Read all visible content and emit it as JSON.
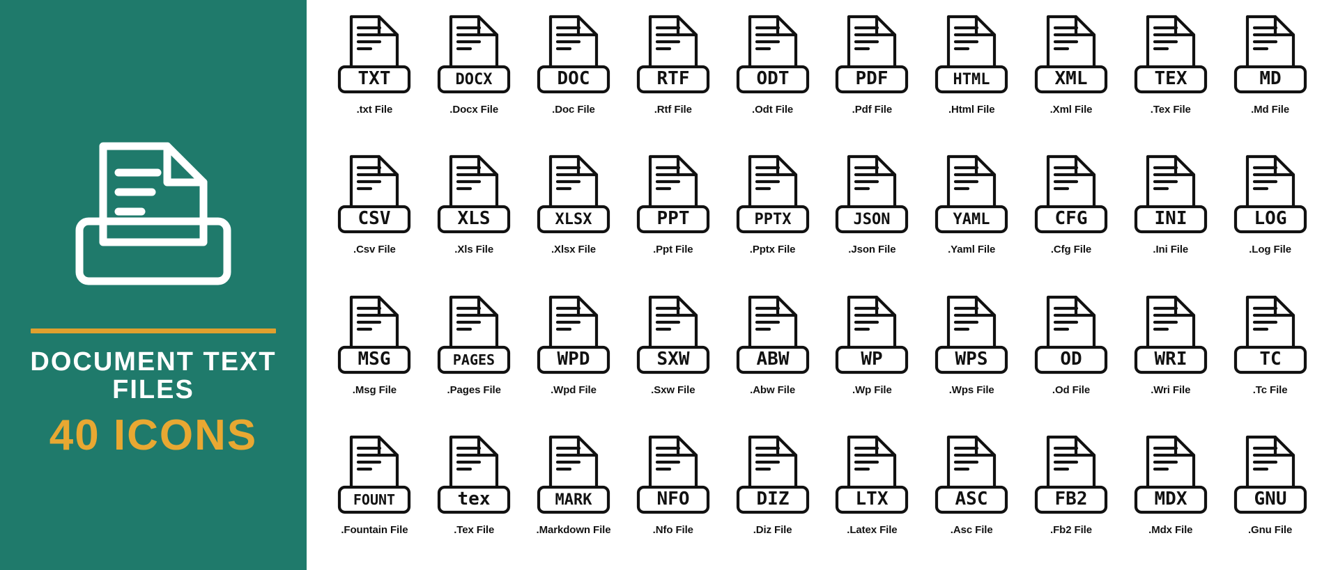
{
  "cover": {
    "logo_icon": "document-text-file-icon",
    "title": "DOCUMENT TEXT FILES",
    "count": "40 ICONS",
    "accent_color": "#e0a02e",
    "background_color": "#1f7a6b",
    "title_color": "#ffffff"
  },
  "grid": {
    "columns": 10,
    "rows": 4,
    "stroke_color": "#111111",
    "icons": [
      {
        "badge": "TXT",
        "caption": ".txt File",
        "icon": "txt-file-icon",
        "lines": 4
      },
      {
        "badge": "DOCX",
        "caption": ".Docx File",
        "icon": "docx-file-icon",
        "lines": 4
      },
      {
        "badge": "DOC",
        "caption": ".Doc File",
        "icon": "doc-file-icon",
        "lines": 4
      },
      {
        "badge": "RTF",
        "caption": ".Rtf File",
        "icon": "rtf-file-icon",
        "lines": 4
      },
      {
        "badge": "ODT",
        "caption": ".Odt File",
        "icon": "odt-file-icon",
        "lines": 4
      },
      {
        "badge": "PDF",
        "caption": ".Pdf File",
        "icon": "pdf-file-icon",
        "lines": 4
      },
      {
        "badge": "HTML",
        "caption": ".Html File",
        "icon": "html-file-icon",
        "lines": 4
      },
      {
        "badge": "XML",
        "caption": ".Xml File",
        "icon": "xml-file-icon",
        "lines": 4
      },
      {
        "badge": "TEX",
        "caption": ".Tex File",
        "icon": "tex-file-icon",
        "lines": 4
      },
      {
        "badge": "MD",
        "caption": ".Md File",
        "icon": "md-file-icon",
        "lines": 4
      },
      {
        "badge": "CSV",
        "caption": ".Csv File",
        "icon": "csv-file-icon",
        "lines": 4
      },
      {
        "badge": "XLS",
        "caption": ".Xls File",
        "icon": "xls-file-icon",
        "lines": 4
      },
      {
        "badge": "XLSX",
        "caption": ".Xlsx File",
        "icon": "xlsx-file-icon",
        "lines": 4
      },
      {
        "badge": "PPT",
        "caption": ".Ppt File",
        "icon": "ppt-file-icon",
        "lines": 4
      },
      {
        "badge": "PPTX",
        "caption": ".Pptx File",
        "icon": "pptx-file-icon",
        "lines": 4
      },
      {
        "badge": "JSON",
        "caption": ".Json File",
        "icon": "json-file-icon",
        "lines": 4
      },
      {
        "badge": "YAML",
        "caption": ".Yaml File",
        "icon": "yaml-file-icon",
        "lines": 4
      },
      {
        "badge": "CFG",
        "caption": ".Cfg File",
        "icon": "cfg-file-icon",
        "lines": 4
      },
      {
        "badge": "INI",
        "caption": ".Ini File",
        "icon": "ini-file-icon",
        "lines": 4
      },
      {
        "badge": "LOG",
        "caption": ".Log File",
        "icon": "log-file-icon",
        "lines": 4
      },
      {
        "badge": "MSG",
        "caption": ".Msg File",
        "icon": "msg-file-icon",
        "lines": 4
      },
      {
        "badge": "PAGES",
        "caption": ".Pages File",
        "icon": "pages-file-icon",
        "lines": 4
      },
      {
        "badge": "WPD",
        "caption": ".Wpd File",
        "icon": "wpd-file-icon",
        "lines": 4
      },
      {
        "badge": "SXW",
        "caption": ".Sxw File",
        "icon": "sxw-file-icon",
        "lines": 4
      },
      {
        "badge": "ABW",
        "caption": ".Abw File",
        "icon": "abw-file-icon",
        "lines": 4
      },
      {
        "badge": "WP",
        "caption": ".Wp File",
        "icon": "wp-file-icon",
        "lines": 4
      },
      {
        "badge": "WPS",
        "caption": ".Wps File",
        "icon": "wps-file-icon",
        "lines": 4
      },
      {
        "badge": "OD",
        "caption": ".Od File",
        "icon": "od-file-icon",
        "lines": 4
      },
      {
        "badge": "WRI",
        "caption": ".Wri File",
        "icon": "wri-file-icon",
        "lines": 4
      },
      {
        "badge": "TC",
        "caption": ".Tc File",
        "icon": "tc-file-icon",
        "lines": 4
      },
      {
        "badge": "FOUNT",
        "caption": ".Fountain File",
        "icon": "fountain-file-icon",
        "lines": 4
      },
      {
        "badge": "tex",
        "caption": ".Tex File",
        "icon": "tex-lower-file-icon",
        "lines": 4
      },
      {
        "badge": "MARK",
        "caption": ".Markdown File",
        "icon": "markdown-file-icon",
        "lines": 4
      },
      {
        "badge": "NFO",
        "caption": ".Nfo File",
        "icon": "nfo-file-icon",
        "lines": 4
      },
      {
        "badge": "DIZ",
        "caption": ".Diz File",
        "icon": "diz-file-icon",
        "lines": 4
      },
      {
        "badge": "LTX",
        "caption": ".Latex File",
        "icon": "latex-file-icon",
        "lines": 4
      },
      {
        "badge": "ASC",
        "caption": ".Asc File",
        "icon": "asc-file-icon",
        "lines": 4
      },
      {
        "badge": "FB2",
        "caption": ".Fb2 File",
        "icon": "fb2-file-icon",
        "lines": 4
      },
      {
        "badge": "MDX",
        "caption": ".Mdx File",
        "icon": "mdx-file-icon",
        "lines": 4
      },
      {
        "badge": "GNU",
        "caption": ".Gnu File",
        "icon": "gnu-file-icon",
        "lines": 4
      }
    ]
  }
}
